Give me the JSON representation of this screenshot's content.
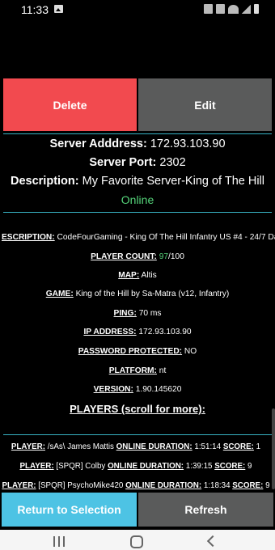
{
  "status_bar": {
    "time": "11:33"
  },
  "actions": {
    "delete_label": "Delete",
    "edit_label": "Edit"
  },
  "server": {
    "address_label": "Server Adddress:",
    "address_value": "172.93.103.90",
    "port_label": "Server Port:",
    "port_value": "2302",
    "description_label": "Description:",
    "description_value": "My Favorite Server-King of The Hill",
    "status": "Online"
  },
  "details": {
    "description_label": "ESCRIPTION:",
    "description_value": "CodeFourGaming - King Of The Hill Infantry US #4 - 24/7 Da",
    "player_count_label": "PLAYER COUNT:",
    "player_count_current": "97",
    "player_count_max": "/100",
    "map_label": "MAP:",
    "map_value": "Altis",
    "game_label": "GAME:",
    "game_value": "King of the Hill by Sa-Matra (v12, Infantry)",
    "ping_label": "PING:",
    "ping_value": "70 ms",
    "ip_label": "IP ADDRESS:",
    "ip_value": "172.93.103.90",
    "password_label": "PASSWORD PROTECTED:",
    "password_value": "NO",
    "platform_label": "PLATFORM:",
    "platform_value": "nt",
    "version_label": "VERSION:",
    "version_value": "1.90.145620"
  },
  "players": {
    "heading": "PLAYERS (scroll for more):",
    "player_label": "PLAYER:",
    "duration_label": "ONLINE DURATION:",
    "score_label": "SCORE:",
    "list": [
      {
        "name": "/sAs\\ James Mattis",
        "duration": "1:51:14",
        "score": "1"
      },
      {
        "name": "[SPQR] Colby",
        "duration": "1:39:15",
        "score": "9"
      },
      {
        "name": "[SPQR] PsychoMike420",
        "duration": "1:18:34",
        "score": "9"
      }
    ]
  },
  "bottom": {
    "return_label": "Return to Selection",
    "refresh_label": "Refresh"
  },
  "colors": {
    "delete": "#f24a4f",
    "edit": "#5a5b5b",
    "return": "#4dc3e4",
    "online": "#55d47a",
    "divider": "#37b2c4"
  }
}
